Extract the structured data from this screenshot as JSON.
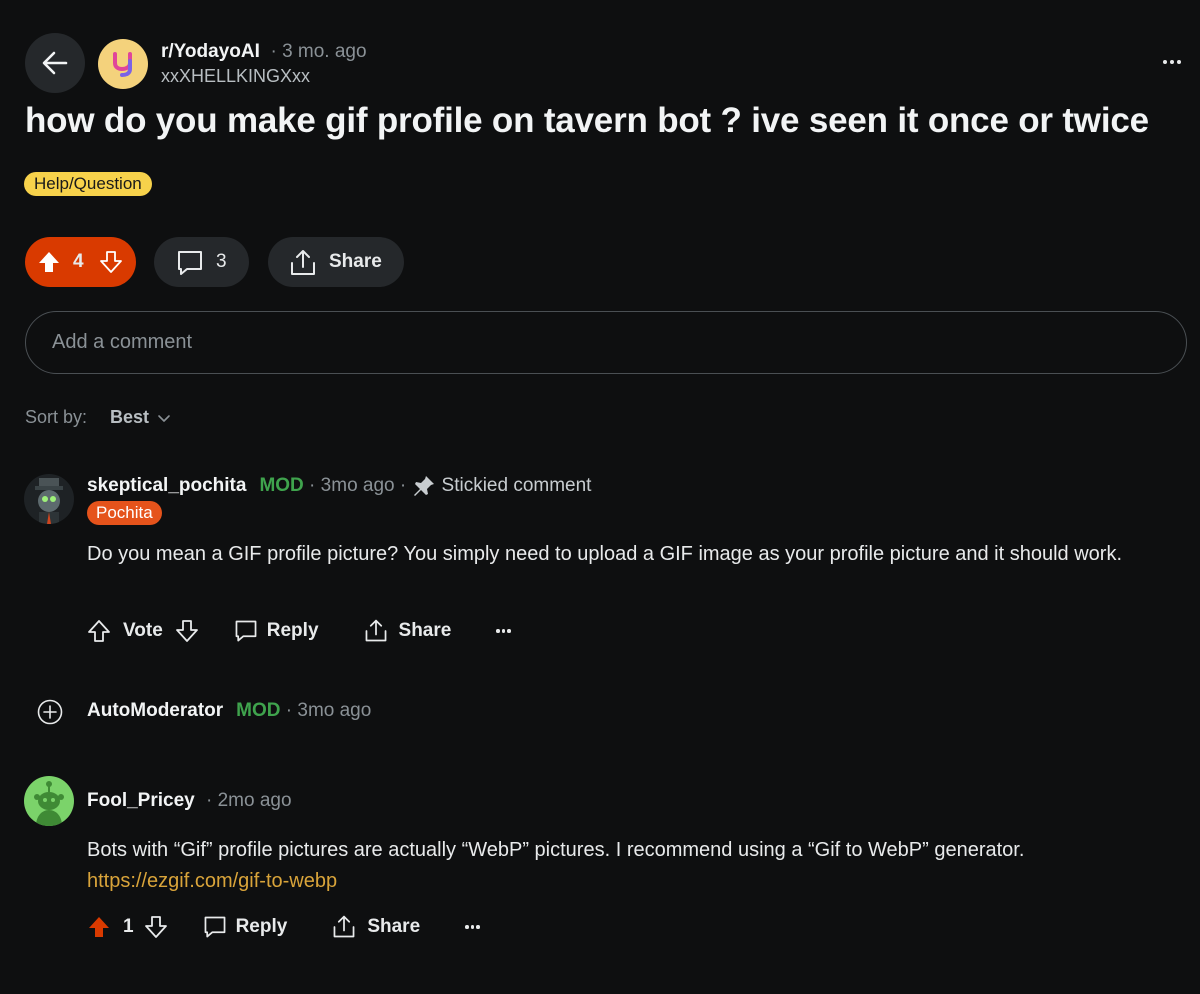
{
  "header": {
    "subreddit": "r/YodayoAI",
    "age": "3 mo. ago",
    "author": "xxXHELLKINGXxx",
    "icons": [
      "back-arrow-icon",
      "more-icon"
    ]
  },
  "post": {
    "title": "how do you make gif profile on tavern bot ? ive seen it once or twice",
    "flair": "Help/Question",
    "score": "4",
    "comment_count": "3",
    "share_label": "Share"
  },
  "comment_input": {
    "placeholder": "Add a comment"
  },
  "sort": {
    "label": "Sort by:",
    "value": "Best"
  },
  "comments": [
    {
      "author": "skeptical_pochita",
      "mod_badge": "MOD",
      "time": "3mo ago",
      "stickied": "Stickied comment",
      "flair": "Pochita",
      "body": "Do you mean a GIF profile picture? You simply need to upload a GIF image as your profile picture and it should work.",
      "vote_label": "Vote",
      "reply_label": "Reply",
      "share_label": "Share"
    },
    {
      "author": "AutoModerator",
      "mod_badge": "MOD",
      "time": "3mo ago",
      "collapsed": true
    },
    {
      "author": "Fool_Pricey",
      "time": "2mo ago",
      "body": "Bots with “Gif” profile pictures are actually “WebP” pictures. I recommend using a “Gif to WebP” generator.",
      "link": "https://ezgif.com/gif-to-webp",
      "score": "1",
      "reply_label": "Reply",
      "share_label": "Share"
    }
  ],
  "colors": {
    "background": "#0e0f10",
    "upvote": "#d93a00",
    "flair_help": "#f7d24b",
    "flair_pochita": "#e5531b",
    "mod": "#3fa34d",
    "link": "#d9a43a"
  }
}
